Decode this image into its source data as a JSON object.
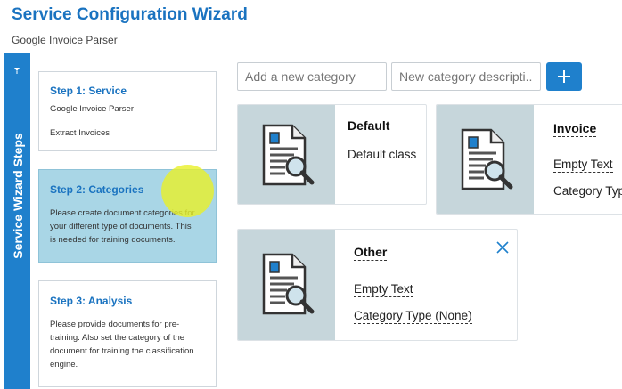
{
  "header": {
    "title": "Service Configuration Wizard",
    "subtitle": "Google Invoice Parser"
  },
  "sidebar": {
    "label": "Service Wizard Steps",
    "pin_icon": "pin-icon"
  },
  "steps": [
    {
      "title": "Step 1: Service",
      "lines": [
        "Google Invoice Parser",
        "Extract Invoices"
      ],
      "active": false
    },
    {
      "title": "Step 2: Categories",
      "lines": [
        "Please create document categories for",
        "your different type of documents. This",
        "is needed for training documents."
      ],
      "active": true
    },
    {
      "title": "Step 3: Analysis",
      "lines": [
        "Please provide documents for pre-",
        "training. Also set the category of the",
        "document for training the classification",
        "engine."
      ],
      "active": false
    }
  ],
  "new_category": {
    "name_placeholder": "Add a new category",
    "description_placeholder": "New category descripti...",
    "add_icon": "plus-icon"
  },
  "categories": [
    {
      "title": "Default",
      "description": "Default class",
      "type": "",
      "icon": "document-search-icon",
      "closable": false
    },
    {
      "title": "Invoice",
      "description": "Empty Text",
      "type": "Category Typ",
      "icon": "document-search-icon",
      "closable": false
    },
    {
      "title": "Other",
      "description": "Empty Text",
      "type": "Category Type (None)",
      "icon": "document-search-icon",
      "closable": true,
      "close_icon": "close-icon"
    }
  ],
  "colors": {
    "accent": "#1f80cc",
    "title_blue": "#1a73c0",
    "active_step_bg": "#a9d6e6",
    "card_image_bg": "#c6d6db",
    "highlight": "#e8f028"
  }
}
